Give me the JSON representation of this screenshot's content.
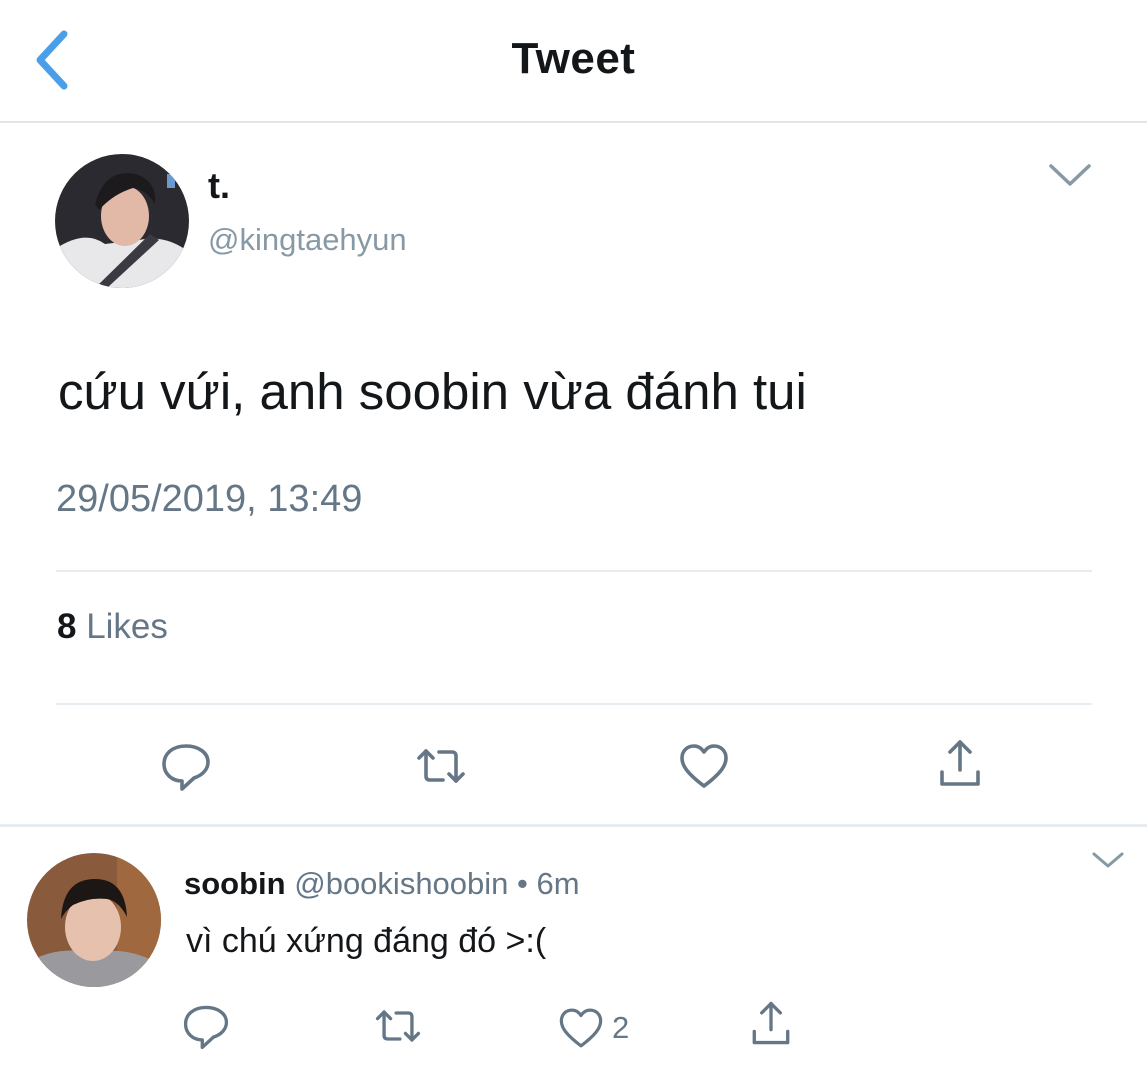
{
  "header": {
    "title": "Tweet",
    "back_icon": "chevron-left-icon",
    "accent": "#4a9fe8"
  },
  "tweet": {
    "display_name": "t.",
    "handle": "@kingtaehyun",
    "text": "cứu vứi, anh soobin vừa đánh tui",
    "timestamp": "29/05/2019, 13:49",
    "likes_count": "8",
    "likes_label": " Likes",
    "actions": [
      "reply-icon",
      "retweet-icon",
      "like-icon",
      "share-icon"
    ]
  },
  "reply": {
    "display_name": "soobin",
    "handle": "@bookishoobin",
    "separator": "•",
    "time": "6m",
    "text": "vì chú xứng đáng đó >:(",
    "like_count": "2",
    "actions": [
      "reply-icon",
      "retweet-icon",
      "like-icon",
      "share-icon"
    ]
  },
  "colors": {
    "text": "#14171a",
    "muted": "#657786",
    "divider": "#e6ecf0",
    "icon": "#657786"
  }
}
